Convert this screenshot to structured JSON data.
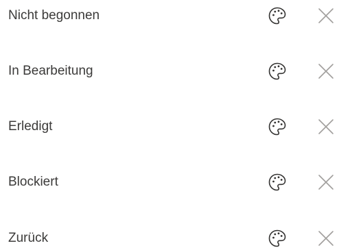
{
  "statuses": [
    {
      "label": "Nicht begonnen",
      "color_icon": "palette-icon",
      "remove_icon": "close-icon"
    },
    {
      "label": "In Bearbeitung",
      "color_icon": "palette-icon",
      "remove_icon": "close-icon"
    },
    {
      "label": "Erledigt",
      "color_icon": "palette-icon",
      "remove_icon": "close-icon"
    },
    {
      "label": "Blockiert",
      "color_icon": "palette-icon",
      "remove_icon": "close-icon"
    },
    {
      "label": "Zurück",
      "color_icon": "palette-icon",
      "remove_icon": "close-icon"
    }
  ],
  "colors": {
    "text": "#3b3a39",
    "palette_icon": "#323130",
    "close_icon": "#a19f9d",
    "background": "#ffffff"
  }
}
